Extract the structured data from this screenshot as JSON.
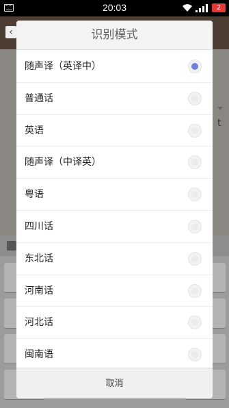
{
  "status_bar": {
    "time": "20:03",
    "battery": "2"
  },
  "background": {
    "back_glyph": "‹",
    "side_char": "t"
  },
  "dialog": {
    "title": "识别模式",
    "options": [
      {
        "label": "随声译（英译中）",
        "selected": true
      },
      {
        "label": "普通话",
        "selected": false
      },
      {
        "label": "英语",
        "selected": false
      },
      {
        "label": "随声译（中译英）",
        "selected": false
      },
      {
        "label": "粤语",
        "selected": false
      },
      {
        "label": "四川话",
        "selected": false
      },
      {
        "label": "东北话",
        "selected": false
      },
      {
        "label": "河南话",
        "selected": false
      },
      {
        "label": "河北话",
        "selected": false
      },
      {
        "label": "闽南语",
        "selected": false
      }
    ],
    "cancel_label": "取消"
  },
  "colors": {
    "radio_selected": "#6f80d8",
    "battery": "#e53935"
  }
}
